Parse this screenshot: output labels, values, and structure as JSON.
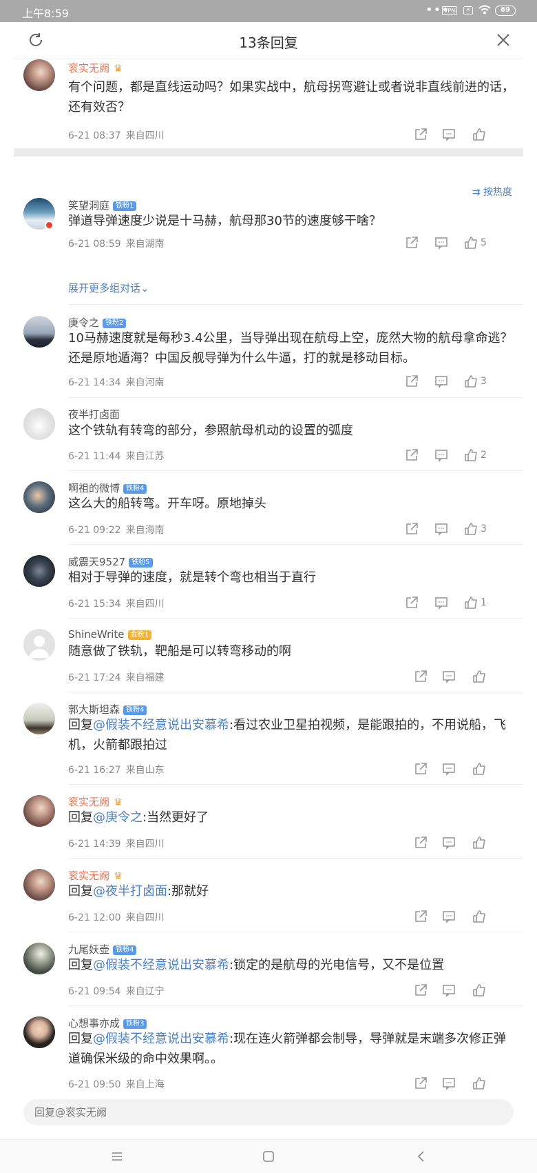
{
  "status_bar": {
    "time": "上午8:59",
    "vpn": "VPN",
    "battery": "69"
  },
  "header": {
    "title": "13条回复"
  },
  "main_comment": {
    "user": "衮实无阙",
    "text": "有个问题，都是直线运动吗？如果实战中，航母拐弯避让或者说非直线前进的话，还有效否？",
    "time": "6-21 08:37",
    "location": "来自四川"
  },
  "sort_label": "按热度",
  "expand_label": "展开更多组对话",
  "replies": [
    {
      "user": "笑望洞庭",
      "badge": "铁粉1",
      "text": "弹道导弹速度少说是十马赫，航母那30节的速度够干啥？",
      "time": "6-21 08:59",
      "location": "来自湖南",
      "likes": "5"
    },
    {
      "user": "庚令之",
      "badge": "铁粉2",
      "text": "10马赫速度就是每秒3.4公里，当导弹出现在航母上空，庞然大物的航母拿命逃？还是原地遁海？中国反舰导弹为什么牛逼，打的就是移动目标。",
      "time": "6-21 14:34",
      "location": "来自河南",
      "likes": "3"
    },
    {
      "user": "夜半打卤面",
      "text": "这个铁轨有转弯的部分，参照航母机动的设置的弧度",
      "time": "6-21 11:44",
      "location": "来自江苏",
      "likes": "2"
    },
    {
      "user": "啊祖的微博",
      "badge": "铁粉4",
      "text": "这么大的船转弯。开车呀。原地掉头",
      "time": "6-21 09:22",
      "location": "来自海南",
      "likes": "3"
    },
    {
      "user": "威震天9527",
      "badge": "铁粉5",
      "text": "相对于导弹的速度，就是转个弯也相当于直行",
      "time": "6-21 15:34",
      "location": "来自四川",
      "likes": "1"
    },
    {
      "user": "ShineWrite",
      "badge": "金粉1",
      "text": "随意做了铁轨，靶船是可以转弯移动的啊",
      "time": "6-21 17:24",
      "location": "来自福建"
    },
    {
      "user": "郭大斯坦森",
      "badge": "铁粉4",
      "reply_prefix": "回复",
      "mention": "@假装不经意说出安慕希",
      "text": ":看过农业卫星拍视频，是能跟拍的，不用说船，飞机，火箭都跟拍过",
      "time": "6-21 16:27",
      "location": "来自山东"
    },
    {
      "user": "衮实无阙",
      "reply_prefix": "回复",
      "mention": "@庚令之",
      "text": ":当然更好了",
      "time": "6-21 14:39",
      "location": "来自四川"
    },
    {
      "user": "衮实无阙",
      "reply_prefix": "回复",
      "mention": "@夜半打卤面",
      "text": ":那就好",
      "time": "6-21 12:00",
      "location": "来自四川"
    },
    {
      "user": "九尾妖壶",
      "badge": "铁粉4",
      "reply_prefix": "回复",
      "mention": "@假装不经意说出安慕希",
      "text": ":锁定的是航母的光电信号，又不是位置",
      "time": "6-21 09:54",
      "location": "来自辽宁"
    },
    {
      "user": "心想事亦成",
      "badge": "铁粉3",
      "reply_prefix": "回复",
      "mention": "@假装不经意说出安慕希",
      "text": ":现在连火箭弹都会制导，导弹就是末端多次修正弹道确保米级的命中效果啊。。",
      "time": "6-21 09:50",
      "location": "来自上海"
    }
  ],
  "reply_input": {
    "placeholder": "回复@衮实无阙"
  }
}
